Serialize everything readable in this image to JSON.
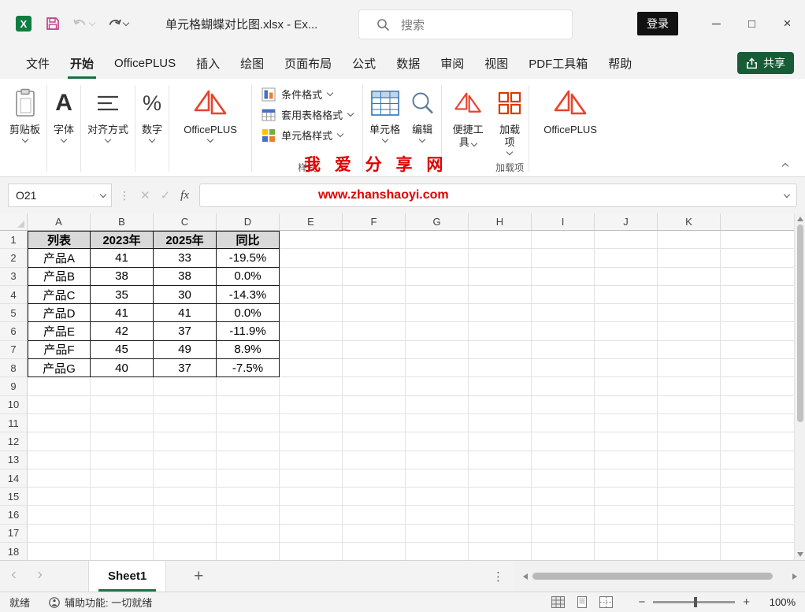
{
  "title_bar": {
    "document_title": "单元格蝴蝶对比图.xlsx  -  Ex...",
    "search_placeholder": "搜索",
    "login_label": "登录"
  },
  "ribbon": {
    "tabs": [
      "文件",
      "开始",
      "OfficePLUS",
      "插入",
      "绘图",
      "页面布局",
      "公式",
      "数据",
      "审阅",
      "视图",
      "PDF工具箱",
      "帮助"
    ],
    "active_tab": "开始",
    "share_label": "共享",
    "buttons": {
      "clipboard": "剪贴板",
      "font": "字体",
      "alignment": "对齐方式",
      "number": "数字",
      "officeplus": "OfficePLUS",
      "conditional_formatting": "条件格式",
      "format_as_table": "套用表格格式",
      "cell_styles": "单元格样式",
      "cells": "单元格",
      "editing": "编辑",
      "convenient_tools": "便捷工具",
      "add_ins": "加载项",
      "officeplus_right": "OfficePLUS"
    },
    "group_labels": {
      "styles": "样式",
      "addins": "加载项"
    }
  },
  "watermark": {
    "line1": "我 爱 分 享 网",
    "line2": "www.zhanshaoyi.com",
    "color": "#e00000"
  },
  "formula_bar": {
    "name_box": "O21",
    "fx": "fx"
  },
  "grid": {
    "columns": [
      "A",
      "B",
      "C",
      "D",
      "E",
      "F",
      "G",
      "H",
      "I",
      "J",
      "K"
    ],
    "rows": [
      "1",
      "2",
      "3",
      "4",
      "5",
      "6",
      "7",
      "8",
      "9",
      "10",
      "11",
      "12",
      "13",
      "14",
      "15",
      "16",
      "17",
      "18"
    ],
    "table": {
      "headers": [
        "列表",
        "2023年",
        "2025年",
        "同比"
      ],
      "rows": [
        [
          "产品A",
          "41",
          "33",
          "-19.5%"
        ],
        [
          "产品B",
          "38",
          "38",
          "0.0%"
        ],
        [
          "产品C",
          "35",
          "30",
          "-14.3%"
        ],
        [
          "产品D",
          "41",
          "41",
          "0.0%"
        ],
        [
          "产品E",
          "42",
          "37",
          "-11.9%"
        ],
        [
          "产品F",
          "45",
          "49",
          "8.9%"
        ],
        [
          "产品G",
          "40",
          "37",
          "-7.5%"
        ]
      ]
    }
  },
  "sheet_bar": {
    "active_tab": "Sheet1",
    "add_label": "+"
  },
  "status_bar": {
    "ready": "就绪",
    "accessibility": "辅助功能: 一切就绪",
    "zoom": "100%"
  },
  "colors": {
    "excel_green": "#217346",
    "share_green": "#185C37",
    "watermark_red": "#e00000"
  }
}
